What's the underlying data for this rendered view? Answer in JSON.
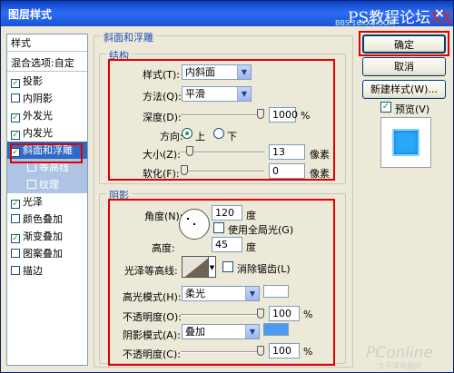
{
  "window": {
    "title": "图层样式",
    "watermark_prefix": "PS教程论坛",
    "watermark_xx": "XX",
    "watermark_url": "BBS.16XX8.COM",
    "close_label": "×"
  },
  "left_panel": {
    "items": [
      {
        "label": "样式",
        "checked": false,
        "kind": "header"
      },
      {
        "label": "混合选项:自定",
        "checked": false,
        "kind": "header"
      },
      {
        "label": "投影",
        "checked": true
      },
      {
        "label": "内阴影",
        "checked": false
      },
      {
        "label": "外发光",
        "checked": true
      },
      {
        "label": "内发光",
        "checked": true
      },
      {
        "label": "斜面和浮雕",
        "checked": true,
        "selected": true
      },
      {
        "label": "等高线",
        "checked": false,
        "sub": true
      },
      {
        "label": "纹理",
        "checked": false,
        "sub": true
      },
      {
        "label": "光泽",
        "checked": true
      },
      {
        "label": "颜色叠加",
        "checked": false
      },
      {
        "label": "渐变叠加",
        "checked": true
      },
      {
        "label": "图案叠加",
        "checked": false
      },
      {
        "label": "描边",
        "checked": false
      }
    ]
  },
  "bevel": {
    "group_title": "斜面和浮雕",
    "structure": {
      "title": "结构",
      "style_label": "样式(T):",
      "style_value": "内斜面",
      "technique_label": "方法(Q):",
      "technique_value": "平滑",
      "depth_label": "深度(D):",
      "depth_value": "1000",
      "depth_unit": "%",
      "depth_level": 1.0,
      "direction_label": "方向:",
      "direction_up": "上",
      "direction_down": "下",
      "direction_selected": "上",
      "size_label": "大小(Z):",
      "size_value": "13",
      "size_unit": "像素",
      "soften_label": "软化(F):",
      "soften_value": "0",
      "soften_unit": "像素"
    },
    "shading": {
      "title": "阴影",
      "angle_label": "角度(N):",
      "angle_value": "120",
      "angle_unit": "度",
      "global_light_label": "使用全局光(G)",
      "global_light_checked": false,
      "altitude_label": "高度:",
      "altitude_value": "45",
      "altitude_unit": "度",
      "gloss_contour_label": "光泽等高线:",
      "anti_aliased_label": "消除锯齿(L)",
      "anti_aliased_checked": false,
      "highlight_mode_label": "高光模式(H):",
      "highlight_mode_value": "柔光",
      "highlight_color": "#ffffff",
      "highlight_opacity_label": "不透明度(O):",
      "highlight_opacity_value": "100",
      "highlight_opacity_unit": "%",
      "shadow_mode_label": "阴影模式(A):",
      "shadow_mode_value": "叠加",
      "shadow_color": "#4b9bf2",
      "shadow_opacity_label": "不透明度(C):",
      "shadow_opacity_value": "100",
      "shadow_opacity_unit": "%"
    }
  },
  "buttons": {
    "ok": "确定",
    "cancel": "取消",
    "new_style": "新建样式(W)...",
    "preview_label": "预览(V)",
    "preview_checked": true
  },
  "footer": {
    "pconline": "PConline",
    "pconline_sub": "太平洋电脑网"
  },
  "colors": {
    "accent_red": "#e00000",
    "preview_fill": "#2aa8f8",
    "label_blue": "#1c4eb5"
  }
}
